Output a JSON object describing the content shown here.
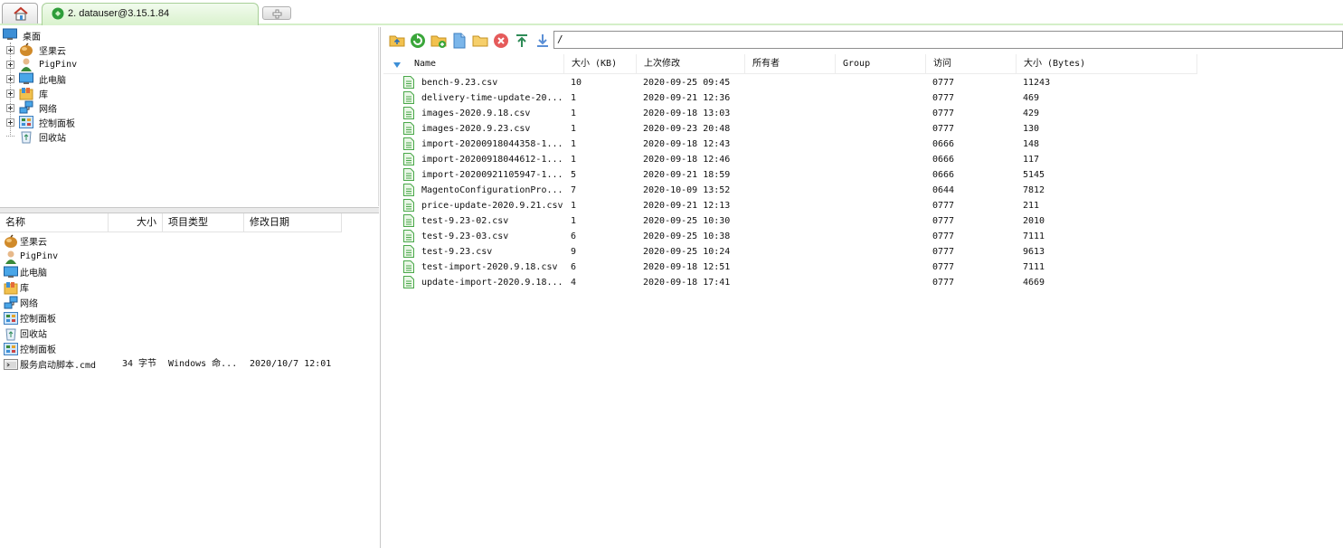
{
  "tabs": {
    "home_icon": "home-icon",
    "session_label": "2. datauser@3.15.1.84",
    "new_tab_icon": "plus-icon"
  },
  "tree": {
    "root": "桌面",
    "items": [
      {
        "label": "坚果云",
        "icon": "nut-cloud-icon",
        "expandable": true
      },
      {
        "label": "PigPinv",
        "icon": "user-icon",
        "expandable": true
      },
      {
        "label": "此电脑",
        "icon": "computer-icon",
        "expandable": true
      },
      {
        "label": "库",
        "icon": "library-icon",
        "expandable": true
      },
      {
        "label": "网络",
        "icon": "network-icon",
        "expandable": true
      },
      {
        "label": "控制面板",
        "icon": "control-panel-icon",
        "expandable": true
      },
      {
        "label": "回收站",
        "icon": "recycle-bin-icon",
        "expandable": false
      }
    ]
  },
  "local_list": {
    "headers": [
      "名称",
      "大小",
      "项目类型",
      "修改日期"
    ],
    "rows": [
      {
        "name": "坚果云",
        "icon": "nut-cloud-icon",
        "size": "",
        "type": "",
        "date": ""
      },
      {
        "name": "PigPinv",
        "icon": "user-icon",
        "size": "",
        "type": "",
        "date": ""
      },
      {
        "name": "此电脑",
        "icon": "computer-icon",
        "size": "",
        "type": "",
        "date": ""
      },
      {
        "name": "库",
        "icon": "library-icon",
        "size": "",
        "type": "",
        "date": ""
      },
      {
        "name": "网络",
        "icon": "network-icon",
        "size": "",
        "type": "",
        "date": ""
      },
      {
        "name": "控制面板",
        "icon": "control-panel-icon",
        "size": "",
        "type": "",
        "date": ""
      },
      {
        "name": "回收站",
        "icon": "recycle-bin-icon",
        "size": "",
        "type": "",
        "date": ""
      },
      {
        "name": "控制面板",
        "icon": "control-panel-icon",
        "size": "",
        "type": "",
        "date": ""
      },
      {
        "name": "服务启动脚本.cmd",
        "icon": "cmd-file-icon",
        "size": "34 字节",
        "type": "Windows 命...",
        "date": "2020/10/7 12:01"
      }
    ]
  },
  "remote": {
    "path": "/",
    "toolbar_icons": [
      "parent-folder-icon",
      "refresh-icon",
      "new-folder-icon",
      "new-file-icon",
      "open-folder-icon",
      "delete-icon",
      "upload-icon",
      "download-icon"
    ],
    "headers": [
      "Name",
      "大小 (KB)",
      "上次修改",
      "所有者",
      "Group",
      "访问",
      "大小 (Bytes)"
    ],
    "rows": [
      {
        "name": "bench-9.23.csv",
        "kb": "10",
        "modified": "2020-09-25 09:45",
        "owner": "",
        "group": "",
        "access": "0777",
        "bytes": "11243"
      },
      {
        "name": "delivery-time-update-20...",
        "kb": "1",
        "modified": "2020-09-21 12:36",
        "owner": "",
        "group": "",
        "access": "0777",
        "bytes": "469"
      },
      {
        "name": "images-2020.9.18.csv",
        "kb": "1",
        "modified": "2020-09-18 13:03",
        "owner": "",
        "group": "",
        "access": "0777",
        "bytes": "429"
      },
      {
        "name": "images-2020.9.23.csv",
        "kb": "1",
        "modified": "2020-09-23 20:48",
        "owner": "",
        "group": "",
        "access": "0777",
        "bytes": "130"
      },
      {
        "name": "import-20200918044358-1...",
        "kb": "1",
        "modified": "2020-09-18 12:43",
        "owner": "",
        "group": "",
        "access": "0666",
        "bytes": "148"
      },
      {
        "name": "import-20200918044612-1...",
        "kb": "1",
        "modified": "2020-09-18 12:46",
        "owner": "",
        "group": "",
        "access": "0666",
        "bytes": "117"
      },
      {
        "name": "import-20200921105947-1...",
        "kb": "5",
        "modified": "2020-09-21 18:59",
        "owner": "",
        "group": "",
        "access": "0666",
        "bytes": "5145"
      },
      {
        "name": "MagentoConfigurationPro...",
        "kb": "7",
        "modified": "2020-10-09 13:52",
        "owner": "",
        "group": "",
        "access": "0644",
        "bytes": "7812"
      },
      {
        "name": "price-update-2020.9.21.csv",
        "kb": "1",
        "modified": "2020-09-21 12:13",
        "owner": "",
        "group": "",
        "access": "0777",
        "bytes": "211"
      },
      {
        "name": "test-9.23-02.csv",
        "kb": "1",
        "modified": "2020-09-25 10:30",
        "owner": "",
        "group": "",
        "access": "0777",
        "bytes": "2010"
      },
      {
        "name": "test-9.23-03.csv",
        "kb": "6",
        "modified": "2020-09-25 10:38",
        "owner": "",
        "group": "",
        "access": "0777",
        "bytes": "7111"
      },
      {
        "name": "test-9.23.csv",
        "kb": "9",
        "modified": "2020-09-25 10:24",
        "owner": "",
        "group": "",
        "access": "0777",
        "bytes": "9613"
      },
      {
        "name": "test-import-2020.9.18.csv",
        "kb": "6",
        "modified": "2020-09-18 12:51",
        "owner": "",
        "group": "",
        "access": "0777",
        "bytes": "7111"
      },
      {
        "name": "update-import-2020.9.18...",
        "kb": "4",
        "modified": "2020-09-18 17:41",
        "owner": "",
        "group": "",
        "access": "0777",
        "bytes": "4669"
      }
    ]
  },
  "colors": {
    "tab_green": "#d9f2cd",
    "accent_blue": "#3d8fd6",
    "file_green": "#4aa84a"
  }
}
